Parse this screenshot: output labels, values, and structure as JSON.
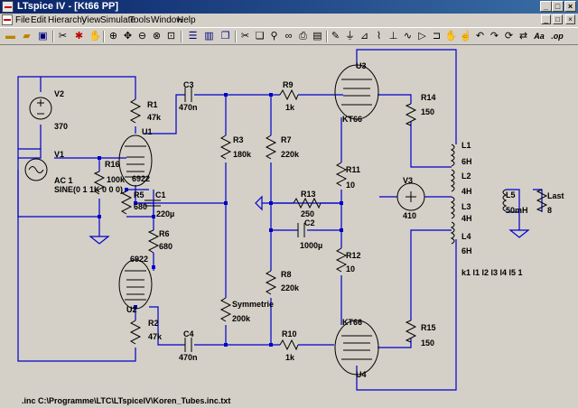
{
  "window": {
    "title": "LTspice IV - [Kt66 PP]",
    "controls": [
      "_",
      "□",
      "×"
    ]
  },
  "menu": {
    "items": [
      "File",
      "Edit",
      "Hierarchy",
      "View",
      "Simulate",
      "Tools",
      "Window",
      "Help"
    ],
    "doc_controls": [
      "_",
      "□",
      "×"
    ]
  },
  "toolbar": {
    "icons": [
      "open-folder",
      "open-folder",
      "save",
      "cut",
      "run",
      "halt",
      "zoom-in",
      "pan",
      "zoom-out",
      "zoom-cancel",
      "zoom-fit",
      "tile-horizontal",
      "tile-vertical",
      "cascade",
      "delete",
      "duplicate",
      "find",
      "print",
      "print-preview",
      "wire",
      "ground",
      "label-net",
      "resistor",
      "capacitor",
      "inductor",
      "diode",
      "component",
      "move",
      "drag",
      "undo",
      "redo",
      "rotate",
      "mirror",
      "text",
      "spice-directive"
    ],
    "text_aa": "Aa",
    "text_op": ".op"
  },
  "schematic": {
    "labels": {
      "V2": "V2",
      "V2_val": "370",
      "R1": "R1",
      "R1_val": "47k",
      "C3": "C3",
      "C3_val": "470n",
      "R9": "R9",
      "R9_val": "1k",
      "U3": "U3",
      "KT66a": "KT66",
      "R14": "R14",
      "R14_val": "150",
      "U1": "U1",
      "tube1": "6922",
      "V1": "V1",
      "V1_ac": "AC 1",
      "V1_sine": "SINE(0 1 1K 0 0 0)",
      "R16": "R16",
      "R16_val": "100k",
      "R5": "R5",
      "R5_val": "680",
      "C1": "C1",
      "C1_val": "220µ",
      "R3": "R3",
      "R3_val": "180k",
      "R7": "R7",
      "R7_val": "220k",
      "R11": "R11",
      "R11_val": "10",
      "V3": "V3",
      "V3_val": "410",
      "L1": "L1",
      "L1_val": "6H",
      "L2": "L2",
      "L2_val": "4H",
      "L3": "L3",
      "L3_val": "4H",
      "L4": "L4",
      "L4_val": "6H",
      "L5": "L5",
      "L5_val": "50mH",
      "Last": "Last",
      "Last_val": "8",
      "R13": "R13",
      "R13_val": "250",
      "C2": "C2",
      "C2_val": "1000µ",
      "R6": "R6",
      "R6_val": "680",
      "tube2": "6922",
      "R12": "R12",
      "R12_val": "10",
      "R8": "R8",
      "R8_val": "220k",
      "kline": "k1 l1 l2 l3 l4 l5 1",
      "Symmetrie": "Symmetrie",
      "Sym_val": "200k",
      "U2": "U2",
      "R2": "R2",
      "R2_val": "47k",
      "C4": "C4",
      "C4_val": "470n",
      "R10": "R10",
      "R10_val": "1k",
      "KT66b": "KT66",
      "R15": "R15",
      "R15_val": "150",
      "U4": "U4",
      "directive": ".inc C:\\Programme\\LTC\\LTspiceIV\\Koren_Tubes.inc.txt"
    }
  }
}
